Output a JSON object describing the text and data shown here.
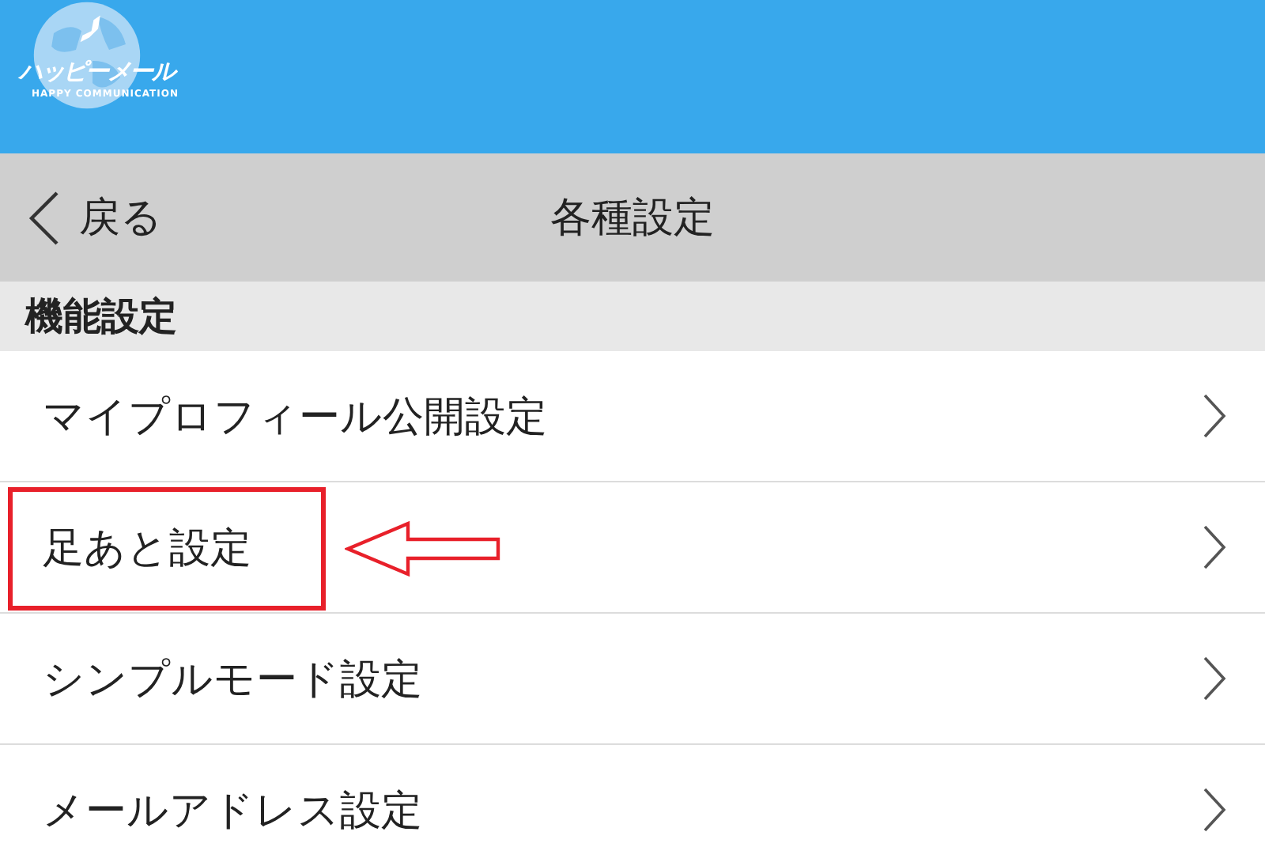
{
  "header": {
    "logo_text": "ハッピーメール",
    "logo_subtitle": "HAPPY COMMUNICATION"
  },
  "nav_bar": {
    "back_label": "戻る",
    "title": "各種設定"
  },
  "section": {
    "title": "機能設定",
    "items": [
      {
        "label": "マイプロフィール公開設定",
        "highlighted": false
      },
      {
        "label": "足あと設定",
        "highlighted": true
      },
      {
        "label": "シンプルモード設定",
        "highlighted": false
      },
      {
        "label": "メールアドレス設定",
        "highlighted": false
      }
    ]
  }
}
